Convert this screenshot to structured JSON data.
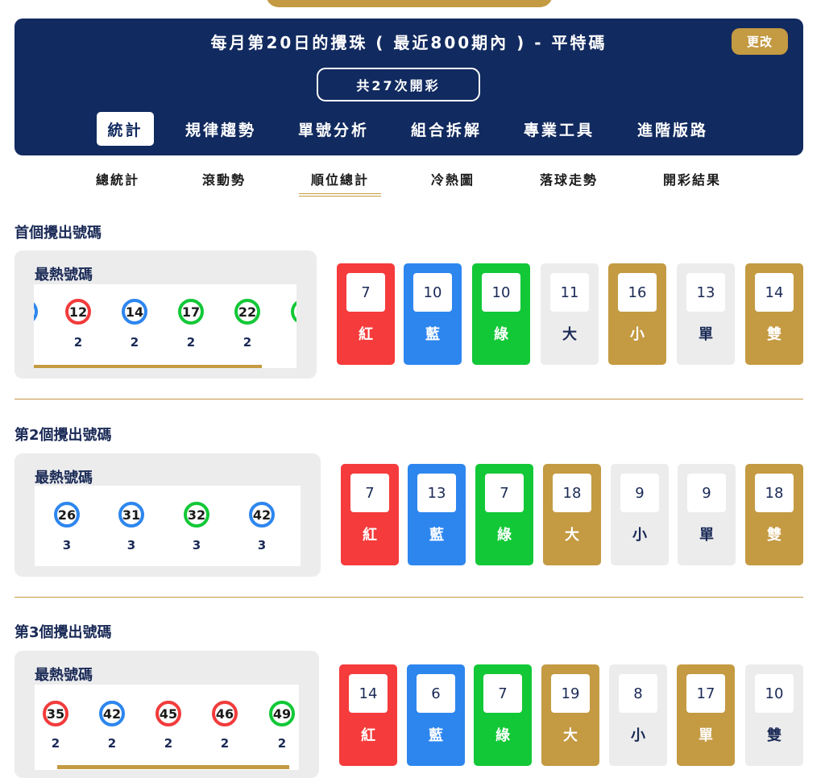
{
  "banner": {
    "title": "每月第20日的攪珠 ( 最近800期內 ) - 平特碼",
    "change_label": "更改",
    "draw_count": "共27次開彩"
  },
  "main_tabs": [
    "統計",
    "規律趨勢",
    "單號分析",
    "組合拆解",
    "專業工具",
    "進階版路"
  ],
  "sub_tabs": [
    "總統計",
    "滾動勢",
    "順位總計",
    "冷熱圖",
    "落球走勢",
    "開彩結果"
  ],
  "sections": [
    {
      "title": "首個攪出號碼",
      "hot_label": "最熱號碼",
      "balls": [
        {
          "number": "12",
          "color": "red",
          "count": "2"
        },
        {
          "number": "14",
          "color": "blue",
          "count": "2"
        },
        {
          "number": "17",
          "color": "green",
          "count": "2"
        },
        {
          "number": "22",
          "color": "green",
          "count": "2"
        }
      ],
      "stats": [
        {
          "value": "7",
          "label": "紅",
          "style": "red"
        },
        {
          "value": "10",
          "label": "藍",
          "style": "blue"
        },
        {
          "value": "10",
          "label": "綠",
          "style": "green"
        },
        {
          "value": "11",
          "label": "大",
          "style": "gray"
        },
        {
          "value": "16",
          "label": "小",
          "style": "gold"
        },
        {
          "value": "13",
          "label": "單",
          "style": "gray"
        },
        {
          "value": "14",
          "label": "雙",
          "style": "gold"
        }
      ]
    },
    {
      "title": "第2個攪出號碼",
      "hot_label": "最熱號碼",
      "balls": [
        {
          "number": "26",
          "color": "blue",
          "count": "3"
        },
        {
          "number": "31",
          "color": "blue",
          "count": "3"
        },
        {
          "number": "32",
          "color": "green",
          "count": "3"
        },
        {
          "number": "42",
          "color": "blue",
          "count": "3"
        }
      ],
      "stats": [
        {
          "value": "7",
          "label": "紅",
          "style": "red"
        },
        {
          "value": "13",
          "label": "藍",
          "style": "blue"
        },
        {
          "value": "7",
          "label": "綠",
          "style": "green"
        },
        {
          "value": "18",
          "label": "大",
          "style": "gold"
        },
        {
          "value": "9",
          "label": "小",
          "style": "gray"
        },
        {
          "value": "9",
          "label": "單",
          "style": "gray"
        },
        {
          "value": "18",
          "label": "雙",
          "style": "gold"
        }
      ]
    },
    {
      "title": "第3個攪出號碼",
      "hot_label": "最熱號碼",
      "balls": [
        {
          "number": "35",
          "color": "red",
          "count": "2"
        },
        {
          "number": "42",
          "color": "blue",
          "count": "2"
        },
        {
          "number": "45",
          "color": "red",
          "count": "2"
        },
        {
          "number": "46",
          "color": "red",
          "count": "2"
        },
        {
          "number": "49",
          "color": "green",
          "count": "2"
        }
      ],
      "stats": [
        {
          "value": "14",
          "label": "紅",
          "style": "red"
        },
        {
          "value": "6",
          "label": "藍",
          "style": "blue"
        },
        {
          "value": "7",
          "label": "綠",
          "style": "green"
        },
        {
          "value": "19",
          "label": "大",
          "style": "gold"
        },
        {
          "value": "8",
          "label": "小",
          "style": "gray"
        },
        {
          "value": "17",
          "label": "單",
          "style": "gold"
        },
        {
          "value": "10",
          "label": "雙",
          "style": "gray"
        }
      ]
    }
  ],
  "colors": {
    "navy": "#112a5f",
    "gold": "#c49a42",
    "red": "#f53b3b",
    "blue": "#2d86ee",
    "green": "#12c837",
    "gray": "#ececec"
  }
}
